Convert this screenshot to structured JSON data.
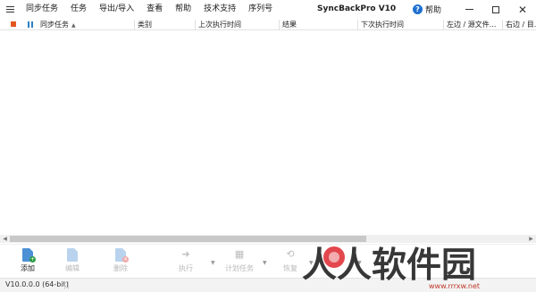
{
  "titlebar": {
    "app_title": "SyncBackPro V10",
    "menu": [
      "同步任务",
      "任务",
      "导出/导入",
      "查看",
      "帮助",
      "技术支持",
      "序列号"
    ],
    "help_label": "帮助",
    "help_icon": "question-circle-icon",
    "window_controls": [
      "minimize-icon",
      "maximize-icon",
      "close-icon"
    ]
  },
  "columns": {
    "stop_icon_color": "#e2571e",
    "pause_icon_color": "#2d7fc3",
    "headers": [
      "同步任务",
      "类别",
      "上次执行时间",
      "结果",
      "下次执行时间",
      "左边 / 源文件...",
      "右边 / 目..."
    ]
  },
  "toolbar": {
    "buttons": [
      {
        "label": "添加",
        "icon": "add-profile-icon",
        "enabled": true
      },
      {
        "label": "编辑",
        "icon": "edit-profile-icon",
        "enabled": false
      },
      {
        "label": "删除",
        "icon": "delete-profile-icon",
        "enabled": false
      },
      {
        "label": "执行",
        "icon": "run-icon",
        "enabled": false
      },
      {
        "label": "计划任务",
        "icon": "schedule-icon",
        "enabled": false
      },
      {
        "label": "恢复",
        "icon": "restore-icon",
        "enabled": false
      }
    ]
  },
  "statusbar": {
    "version": "V10.0.0.0 (64-bit)"
  },
  "watermark": {
    "text": "人人软件园",
    "url": "www.rrrxw.net"
  },
  "colors": {
    "accent": "#4c90d6",
    "accent_disabled": "#b9d3ee",
    "help_blue": "#1f6fd1",
    "watermark_red": "#e0343a"
  }
}
